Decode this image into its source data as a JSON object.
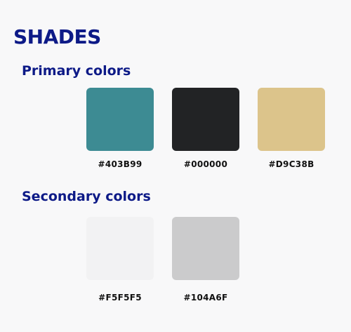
{
  "page": {
    "title": "SHADES"
  },
  "sections": [
    {
      "heading": "Primary colors",
      "swatches": [
        {
          "code": "#403B99",
          "fill": "#3d8b93"
        },
        {
          "code": "#000000",
          "fill": "#222325"
        },
        {
          "code": "#D9C38B",
          "fill": "#dcc48b"
        }
      ]
    },
    {
      "heading": "Secondary colors",
      "swatches": [
        {
          "code": "#F5F5F5",
          "fill": "#f2f2f3"
        },
        {
          "code": "#104A6F",
          "fill": "#cbcbcc"
        }
      ]
    }
  ],
  "colors": {
    "heading": "#0d1a87",
    "background": "#f8f8f9",
    "code_text": "#111111"
  }
}
